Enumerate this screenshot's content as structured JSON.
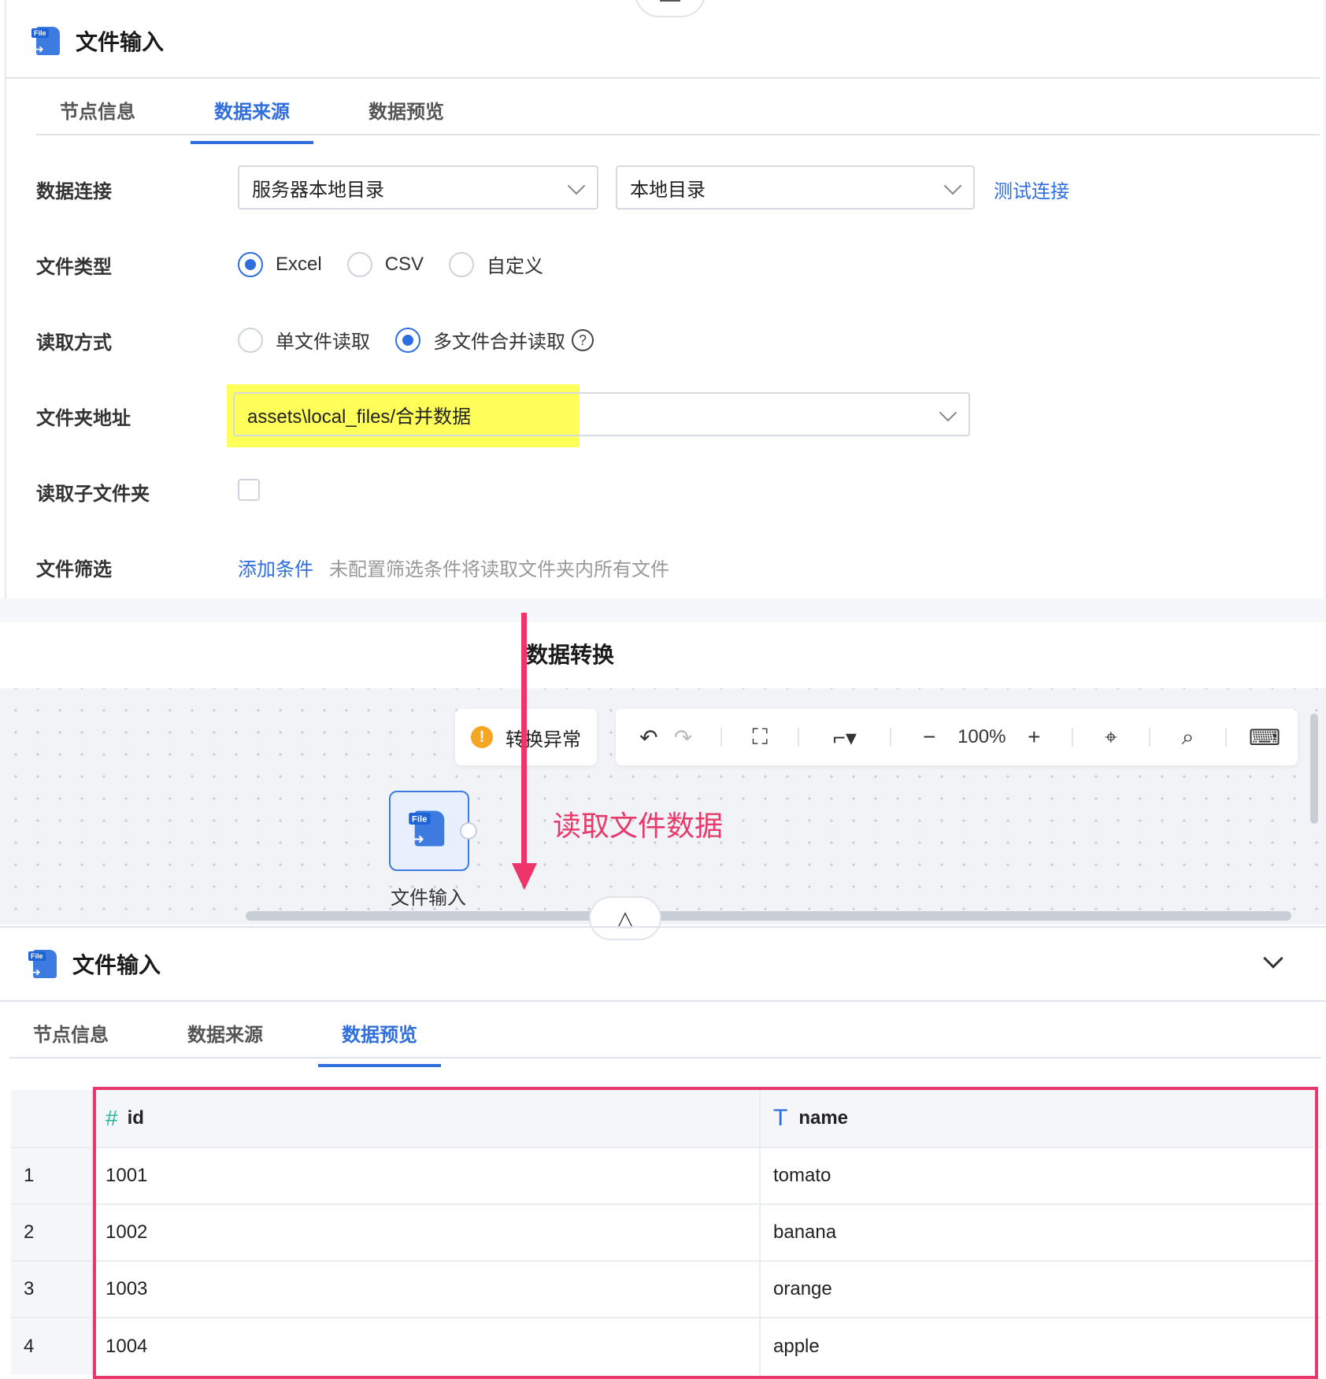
{
  "top_panel": {
    "title": "文件输入",
    "tabs": [
      "节点信息",
      "数据来源",
      "数据预览"
    ],
    "active_tab": "数据来源",
    "form": {
      "connection": {
        "label": "数据连接",
        "select1": "服务器本地目录",
        "select2": "本地目录",
        "test_link": "测试连接"
      },
      "file_type": {
        "label": "文件类型",
        "options": [
          "Excel",
          "CSV",
          "自定义"
        ],
        "selected": "Excel"
      },
      "read_mode": {
        "label": "读取方式",
        "options": [
          "单文件读取",
          "多文件合并读取"
        ],
        "selected": "多文件合并读取"
      },
      "folder": {
        "label": "文件夹地址",
        "value": "assets\\local_files/合并数据"
      },
      "subfolder": {
        "label": "读取子文件夹",
        "checked": false
      },
      "filter": {
        "label": "文件筛选",
        "add_link": "添加条件",
        "hint": "未配置筛选条件将读取文件夹内所有文件"
      }
    }
  },
  "middle": {
    "section_title": "数据转换",
    "status": "转换异常",
    "zoom": "100%",
    "node": {
      "label": "文件输入",
      "icon_tag": "File"
    },
    "annotation": "读取文件数据"
  },
  "bottom_panel": {
    "title": "文件输入",
    "tabs": [
      "节点信息",
      "数据来源",
      "数据预览"
    ],
    "active_tab": "数据预览",
    "table": {
      "columns": [
        {
          "name": "id",
          "type_icon": "#"
        },
        {
          "name": "name",
          "type_icon": "T"
        }
      ],
      "rows": [
        {
          "idx": "1",
          "id": "1001",
          "name": "tomato"
        },
        {
          "idx": "2",
          "id": "1002",
          "name": "banana"
        },
        {
          "idx": "3",
          "id": "1003",
          "name": "orange"
        },
        {
          "idx": "4",
          "id": "1004",
          "name": "apple"
        }
      ]
    }
  },
  "colors": {
    "accent": "#2f6ede",
    "annotation": "#e8396a",
    "highlight": "#ffff5a",
    "warning": "#f5a623"
  }
}
